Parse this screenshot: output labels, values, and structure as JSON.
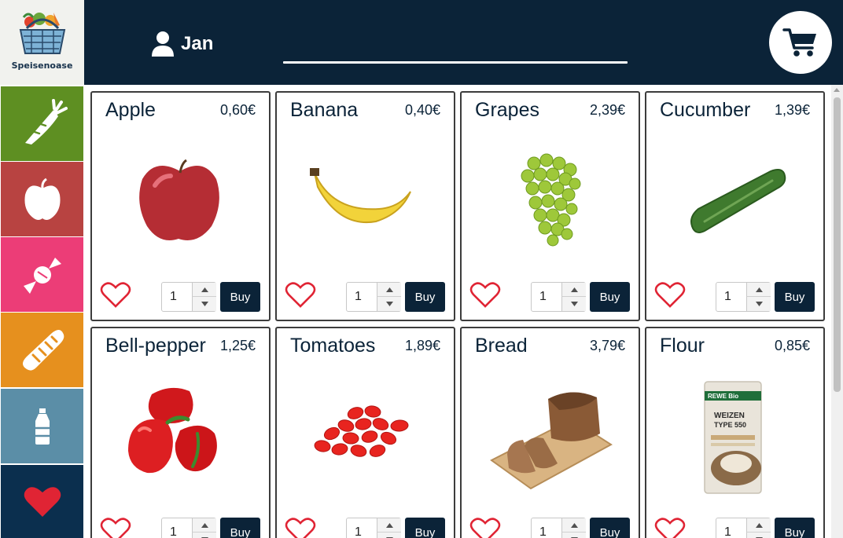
{
  "header": {
    "logo_text": "Speisenoase",
    "user_name": "Jan",
    "search_value": "",
    "icons": {
      "logo": "grocery-basket-logo",
      "user": "user-icon",
      "cart": "cart-icon"
    }
  },
  "sidebar": {
    "categories": [
      {
        "icon": "carrot-icon",
        "color": "#5e8f22"
      },
      {
        "icon": "apple-icon",
        "color": "#b84341"
      },
      {
        "icon": "candy-icon",
        "color": "#ec3d77"
      },
      {
        "icon": "bread-icon",
        "color": "#e6901e"
      },
      {
        "icon": "bottle-icon",
        "color": "#5b8ea7"
      },
      {
        "icon": "heart-icon",
        "color": "#0b2f4e"
      }
    ]
  },
  "products": [
    {
      "name": "Apple",
      "price": "0,60€",
      "qty": "1",
      "buy_label": "Buy"
    },
    {
      "name": "Banana",
      "price": "0,40€",
      "qty": "1",
      "buy_label": "Buy"
    },
    {
      "name": "Grapes",
      "price": "2,39€",
      "qty": "1",
      "buy_label": "Buy"
    },
    {
      "name": "Cucumber",
      "price": "1,39€",
      "qty": "1",
      "buy_label": "Buy"
    },
    {
      "name": "Bell-pepper",
      "price": "1,25€",
      "qty": "1",
      "buy_label": "Buy"
    },
    {
      "name": "Tomatoes",
      "price": "1,89€",
      "qty": "1",
      "buy_label": "Buy"
    },
    {
      "name": "Bread",
      "price": "3,79€",
      "qty": "1",
      "buy_label": "Buy"
    },
    {
      "name": "Flour",
      "price": "0,85€",
      "qty": "1",
      "buy_label": "Buy",
      "package_brand": "REWE Bio",
      "package_text_1": "WEIZEN",
      "package_text_2": "TYPE 550"
    }
  ],
  "colors": {
    "navy": "#0b2338",
    "heart_red": "#e02434"
  }
}
